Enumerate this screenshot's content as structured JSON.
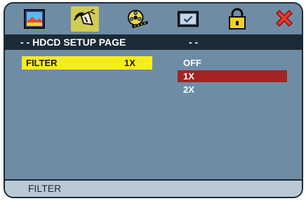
{
  "icons": [
    {
      "name": "picture-icon"
    },
    {
      "name": "audio-speaker-icon",
      "selected": true
    },
    {
      "name": "film-reel-icon"
    },
    {
      "name": "check-box-icon"
    },
    {
      "name": "lock-icon"
    },
    {
      "name": "close-icon"
    }
  ],
  "title": {
    "left": "- - HDCD SETUP PAGE",
    "right": "- -"
  },
  "setting": {
    "label": "FILTER",
    "value": "1X"
  },
  "options": [
    {
      "label": "OFF"
    },
    {
      "label": "1X",
      "selected": true
    },
    {
      "label": "2X"
    }
  ],
  "status": {
    "text": "FILTER"
  },
  "colors": {
    "panel": "#6f8ca5",
    "title_bar": "#1c2a36",
    "highlight_row": "#f6ee1c",
    "selected_option": "#a52323",
    "status_bar": "#b9c9d6"
  }
}
